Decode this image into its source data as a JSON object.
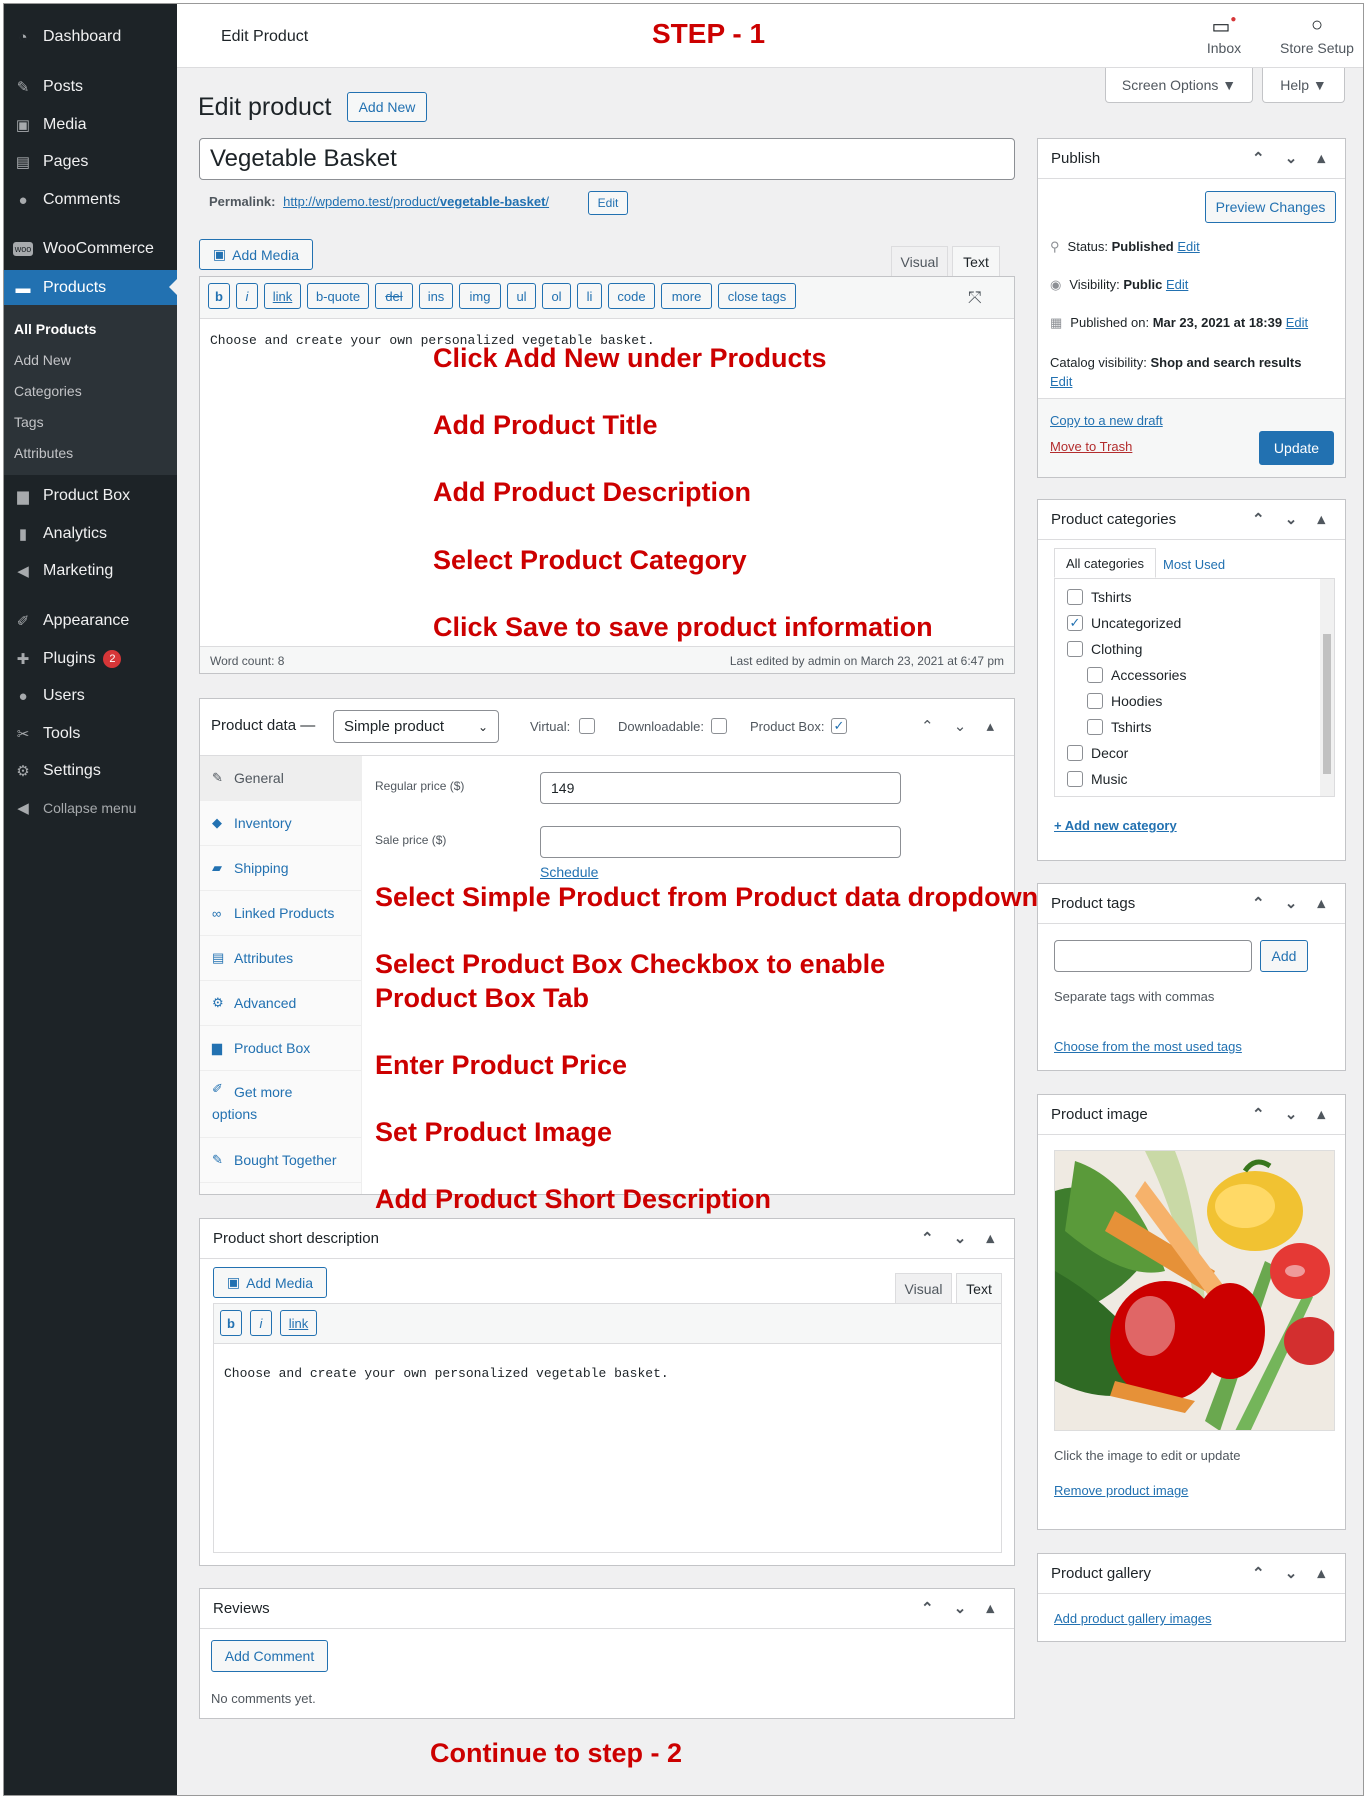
{
  "sidebar": {
    "items": [
      {
        "label": "Dashboard",
        "icon": "dashboard-icon"
      },
      {
        "label": "Posts",
        "icon": "pin-icon"
      },
      {
        "label": "Media",
        "icon": "media-icon"
      },
      {
        "label": "Pages",
        "icon": "pages-icon"
      },
      {
        "label": "Comments",
        "icon": "comments-icon"
      },
      {
        "label": "WooCommerce",
        "icon": "woo-icon"
      },
      {
        "label": "Products",
        "icon": "products-icon"
      },
      {
        "label": "Product Box",
        "icon": "product-box-icon"
      },
      {
        "label": "Analytics",
        "icon": "analytics-icon"
      },
      {
        "label": "Marketing",
        "icon": "megaphone-icon"
      },
      {
        "label": "Appearance",
        "icon": "brush-icon"
      },
      {
        "label": "Plugins",
        "icon": "plugin-icon",
        "badge": "2"
      },
      {
        "label": "Users",
        "icon": "user-icon"
      },
      {
        "label": "Tools",
        "icon": "wrench-icon"
      },
      {
        "label": "Settings",
        "icon": "settings-icon"
      },
      {
        "label": "Collapse menu",
        "icon": "collapse-icon"
      }
    ],
    "submenu": [
      "All Products",
      "Add New",
      "Categories",
      "Tags",
      "Attributes"
    ]
  },
  "topbar": {
    "title": "Edit Product",
    "step": "STEP - 1",
    "inbox": "Inbox",
    "store_setup": "Store Setup"
  },
  "screen_options": "Screen Options ▼",
  "help": "Help ▼",
  "page": {
    "heading": "Edit product",
    "add_new": "Add New"
  },
  "title_input": "Vegetable Basket",
  "permalink": {
    "label": "Permalink:",
    "url_prefix": "http://wpdemo.test/product/",
    "slug": "vegetable-basket",
    "slash": "/",
    "edit": "Edit"
  },
  "editor": {
    "add_media": "Add Media",
    "tab_visual": "Visual",
    "tab_text": "Text",
    "quicktags": [
      "b",
      "i",
      "link",
      "b-quote",
      "del",
      "ins",
      "img",
      "ul",
      "ol",
      "li",
      "code",
      "more",
      "close tags"
    ],
    "content": "Choose and create your own personalized vegetable basket.",
    "word_count": "Word count: 8",
    "last_edited": "Last edited by admin on March 23, 2021 at 6:47 pm"
  },
  "annotations": {
    "a1": "Click Add New under Products",
    "a2": "Add Product Title",
    "a3": "Add Product Description",
    "a4": "Select Product Category",
    "a5": "Click Save to save product information",
    "b1": "Select Simple Product from Product data dropdown",
    "b2": "Select Product Box Checkbox to enable",
    "b2b": "Product Box Tab",
    "b3": "Enter Product Price",
    "b4": "Set Product Image",
    "b5": "Add Product Short Description",
    "continue": "Continue to step - 2"
  },
  "product_data": {
    "label": "Product data —",
    "type": "Simple product",
    "virtual": "Virtual:",
    "downloadable": "Downloadable:",
    "product_box": "Product Box:",
    "tabs": [
      "General",
      "Inventory",
      "Shipping",
      "Linked Products",
      "Attributes",
      "Advanced",
      "Product Box",
      "Get more",
      "options",
      "Bought Together"
    ],
    "regular_price_label": "Regular price ($)",
    "regular_price": "149",
    "sale_price_label": "Sale price ($)",
    "schedule": "Schedule"
  },
  "short_desc": {
    "title": "Product short description",
    "add_media": "Add Media",
    "tab_visual": "Visual",
    "tab_text": "Text",
    "quicktags": [
      "b",
      "i",
      "link"
    ],
    "content": "Choose and create your own personalized vegetable basket."
  },
  "reviews": {
    "title": "Reviews",
    "add_comment": "Add Comment",
    "empty": "No comments yet."
  },
  "publish": {
    "title": "Publish",
    "preview": "Preview Changes",
    "status_label": "Status:",
    "status": "Published",
    "visibility_label": "Visibility:",
    "visibility": "Public",
    "published_label": "Published on:",
    "published": "Mar 23, 2021 at 18:39",
    "catalog_label": "Catalog visibility:",
    "catalog": "Shop and search results",
    "edit": "Edit",
    "copy": "Copy to a new draft",
    "trash": "Move to Trash",
    "update": "Update"
  },
  "categories": {
    "title": "Product categories",
    "tab_all": "All categories",
    "tab_used": "Most Used",
    "items": [
      {
        "label": "Tshirts",
        "checked": false,
        "level": 0
      },
      {
        "label": "Uncategorized",
        "checked": true,
        "level": 0
      },
      {
        "label": "Clothing",
        "checked": false,
        "level": 0
      },
      {
        "label": "Accessories",
        "checked": false,
        "level": 1
      },
      {
        "label": "Hoodies",
        "checked": false,
        "level": 1
      },
      {
        "label": "Tshirts",
        "checked": false,
        "level": 1
      },
      {
        "label": "Decor",
        "checked": false,
        "level": 0
      },
      {
        "label": "Music",
        "checked": false,
        "level": 0
      }
    ],
    "add_new": "+ Add new category"
  },
  "tags": {
    "title": "Product tags",
    "add": "Add",
    "hint": "Separate tags with commas",
    "choose": "Choose from the most used tags"
  },
  "image": {
    "title": "Product image",
    "hint": "Click the image to edit or update",
    "remove": "Remove product image"
  },
  "gallery": {
    "title": "Product gallery",
    "add": "Add product gallery images"
  },
  "box_controls": "⌃ ⌄ ▴"
}
